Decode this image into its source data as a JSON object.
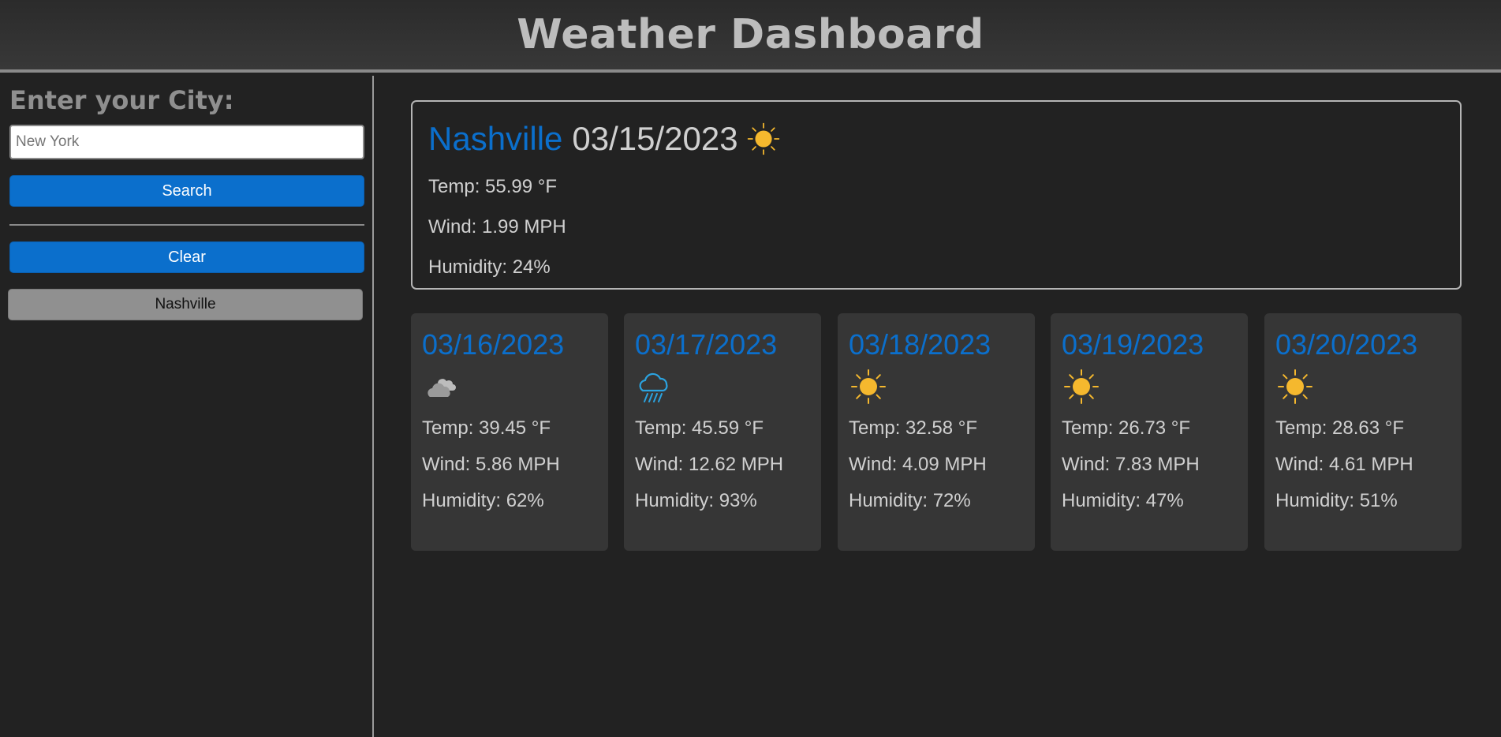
{
  "header": {
    "title": "Weather Dashboard"
  },
  "sidebar": {
    "label": "Enter your City:",
    "search_placeholder": "New York",
    "search_label": "Search",
    "clear_label": "Clear",
    "history": [
      "Nashville"
    ]
  },
  "current": {
    "city": "Nashville",
    "date": "03/15/2023",
    "icon": "sun-icon",
    "temp": "Temp: 55.99 °F",
    "wind": "Wind: 1.99 MPH",
    "humidity": "Humidity: 24%"
  },
  "forecast": [
    {
      "date": "03/16/2023",
      "icon": "clouds-icon",
      "temp": "Temp: 39.45 °F",
      "wind": "Wind: 5.86 MPH",
      "humidity": "Humidity: 62%"
    },
    {
      "date": "03/17/2023",
      "icon": "rain-icon",
      "temp": "Temp: 45.59 °F",
      "wind": "Wind: 12.62 MPH",
      "humidity": "Humidity: 93%"
    },
    {
      "date": "03/18/2023",
      "icon": "sun-icon",
      "temp": "Temp: 32.58 °F",
      "wind": "Wind: 4.09 MPH",
      "humidity": "Humidity: 72%"
    },
    {
      "date": "03/19/2023",
      "icon": "sun-icon",
      "temp": "Temp: 26.73 °F",
      "wind": "Wind: 7.83 MPH",
      "humidity": "Humidity: 47%"
    },
    {
      "date": "03/20/2023",
      "icon": "sun-icon",
      "temp": "Temp: 28.63 °F",
      "wind": "Wind: 4.61 MPH",
      "humidity": "Humidity: 51%"
    }
  ],
  "colors": {
    "accent": "#0b6fcc",
    "background": "#222222",
    "card": "#363636",
    "history_button": "#909090",
    "sun": "#f5b82e"
  }
}
